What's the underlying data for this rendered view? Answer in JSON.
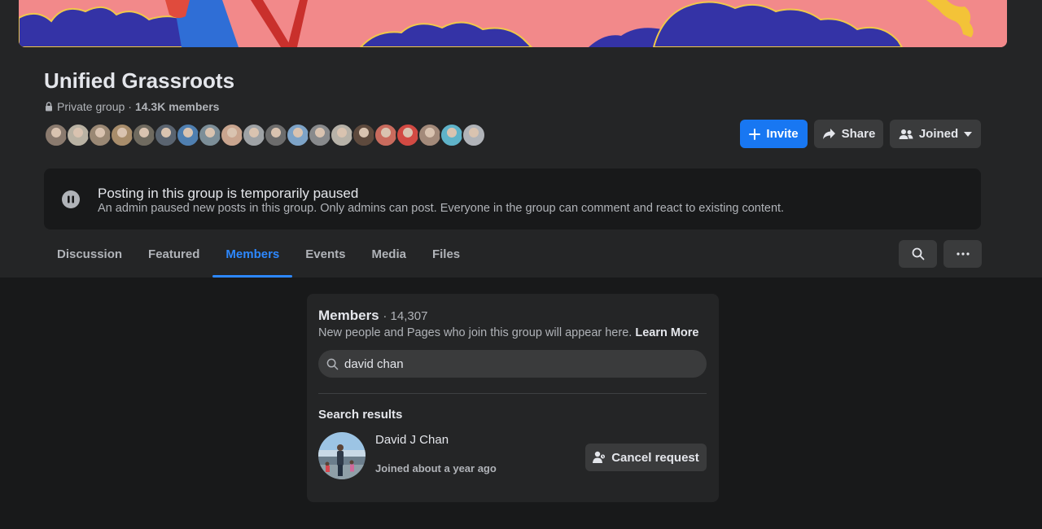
{
  "group": {
    "title": "Unified Grassroots",
    "privacy": "Private group",
    "separator": "·",
    "members_short": "14.3K members",
    "member_avatar_colors": [
      "#8a7a6e",
      "#b9b2a3",
      "#9a8874",
      "#a88d6b",
      "#6f6a5f",
      "#5a6470",
      "#4f7fb0",
      "#7c8e98",
      "#c9a58f",
      "#9ea2a5",
      "#6c6c6c",
      "#7da3c7",
      "#888a8c",
      "#b7b2a8",
      "#5e4a3d",
      "#c96b5d",
      "#d24a43",
      "#a38a7a",
      "#5fb3c9",
      "#b0b3b8"
    ]
  },
  "actions": {
    "invite_label": "Invite",
    "share_label": "Share",
    "joined_label": "Joined"
  },
  "notice": {
    "title": "Posting in this group is temporarily paused",
    "text": "An admin paused new posts in this group. Only admins can post. Everyone in the group can comment and react to existing content."
  },
  "tabs": [
    {
      "label": "Discussion"
    },
    {
      "label": "Featured"
    },
    {
      "label": "Members"
    },
    {
      "label": "Events"
    },
    {
      "label": "Media"
    },
    {
      "label": "Files"
    }
  ],
  "members": {
    "title": "Members",
    "count": "· 14,307",
    "subtitle": "New people and Pages who join this group will appear here.",
    "learn_more": "Learn More",
    "search_value": "david chan",
    "results_label": "Search results",
    "result": {
      "name": "David J Chan",
      "joined": "Joined about a year ago",
      "action_label": "Cancel request"
    }
  },
  "colors": {
    "accent": "#1877f2",
    "active_tab": "#2d88ff",
    "cover_pink": "#f2898a",
    "cover_blue": "#3433a6"
  }
}
